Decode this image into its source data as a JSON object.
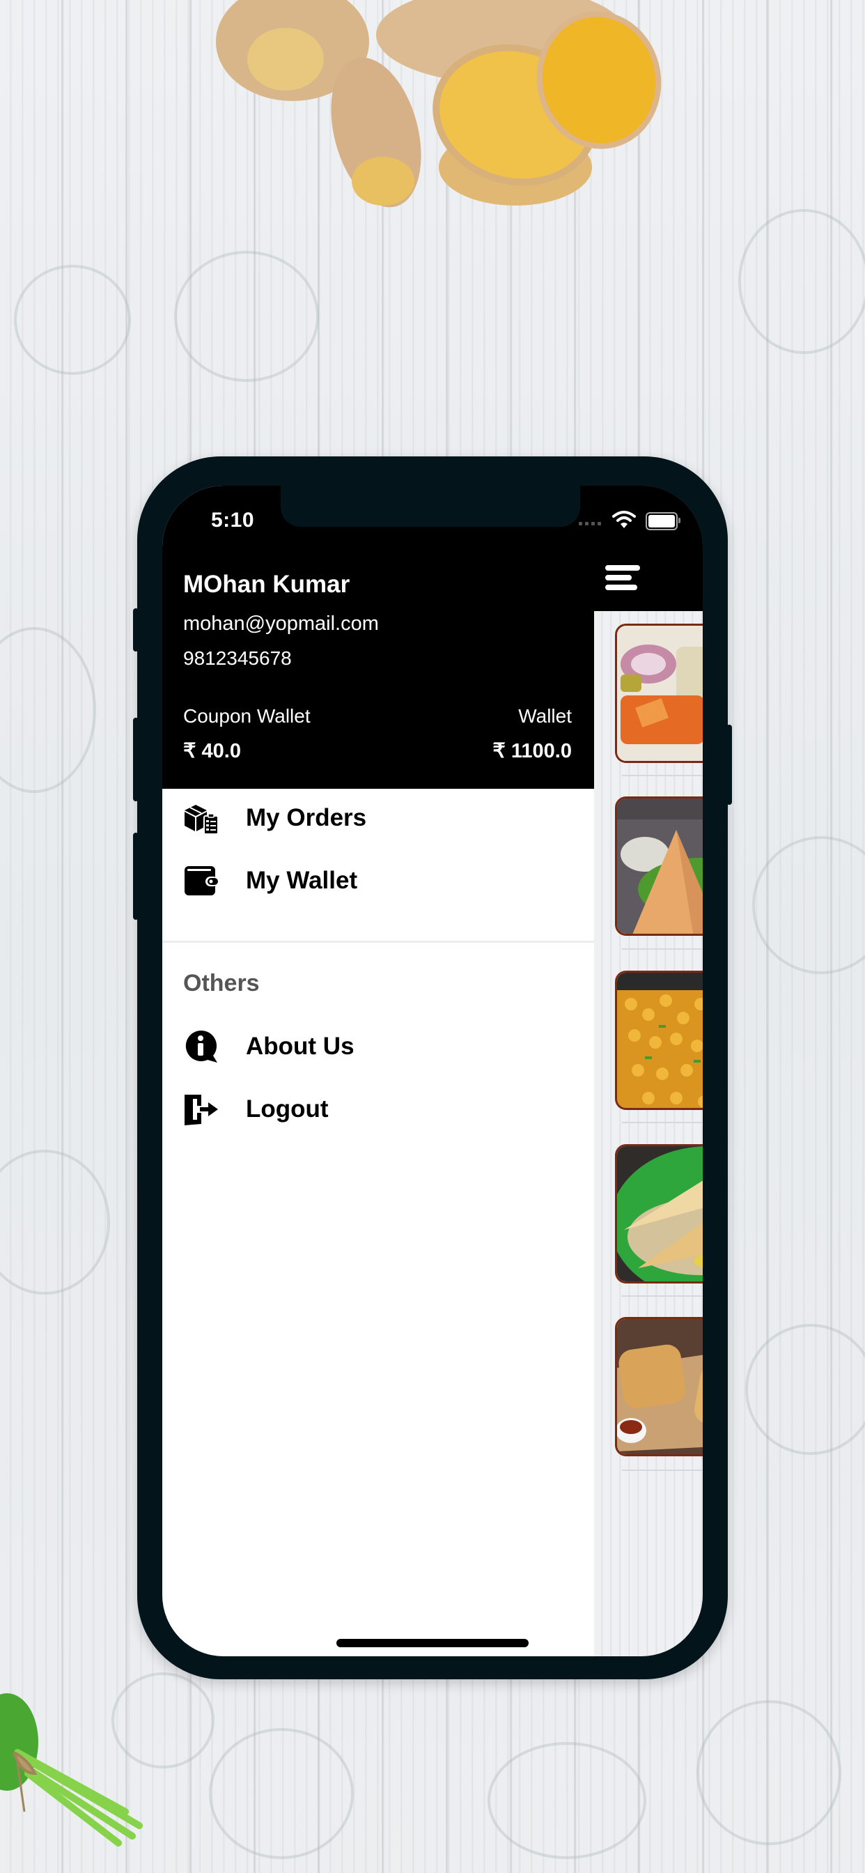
{
  "status_bar": {
    "time": "5:10",
    "wifi_icon": "wifi-icon",
    "battery_icon": "battery-icon"
  },
  "drawer": {
    "user": {
      "name": "MOhan Kumar",
      "email": "mohan@yopmail.com",
      "phone": "9812345678"
    },
    "wallets": {
      "coupon_label": "Coupon Wallet",
      "coupon_value": "₹ 40.0",
      "wallet_label": "Wallet",
      "wallet_value": "₹ 1100.0"
    },
    "menu": [
      {
        "label": "My Orders",
        "icon": "orders-box-icon"
      },
      {
        "label": "My Wallet",
        "icon": "wallet-icon"
      }
    ],
    "others_title": "Others",
    "others": [
      {
        "label": "About Us",
        "icon": "info-bubble-icon"
      },
      {
        "label": "Logout",
        "icon": "logout-door-icon"
      }
    ]
  },
  "main": {
    "menu_icon": "hamburger-menu-icon",
    "food_items": [
      {
        "name": "thali",
        "colors": [
          "#f2ede4",
          "#e36a28",
          "#d9c89a"
        ]
      },
      {
        "name": "samosa",
        "colors": [
          "#5f5a5e",
          "#e3a25e",
          "#4f9a2e"
        ]
      },
      {
        "name": "chana",
        "colors": [
          "#2a2a2a",
          "#e0a22d",
          "#c9841c"
        ]
      },
      {
        "name": "dosa",
        "colors": [
          "#2f2c2a",
          "#2fa63c",
          "#e8c27a"
        ]
      },
      {
        "name": "puff",
        "colors": [
          "#5a4032",
          "#d9a862",
          "#caa77a"
        ]
      }
    ]
  },
  "colors": {
    "phone_frame": "#04141b",
    "header_bg": "#000000",
    "thumb_border": "#7a2a14",
    "section_title": "#555555"
  }
}
